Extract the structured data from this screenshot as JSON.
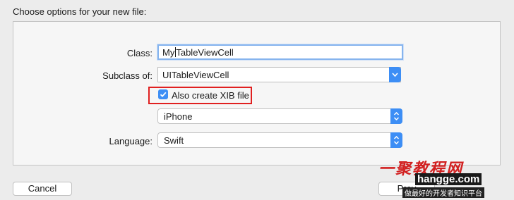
{
  "heading": "Choose options for your new file:",
  "form": {
    "class_label": "Class:",
    "class_value_before": "My",
    "class_value_after": "TableViewCell",
    "subclass_label": "Subclass of:",
    "subclass_value": "UITableViewCell",
    "xib_checkbox_label": "Also create XIB file",
    "xib_checked": true,
    "device_value": "iPhone",
    "language_label": "Language:",
    "language_value": "Swift"
  },
  "buttons": {
    "cancel": "Cancel",
    "previous": "Prev"
  },
  "watermark": {
    "site_name": "一聚教程网",
    "url": "hangge.com",
    "tagline": "做最好的开发者知识平台"
  },
  "colors": {
    "accent": "#3d8ef5",
    "highlight_box": "#e02020"
  }
}
